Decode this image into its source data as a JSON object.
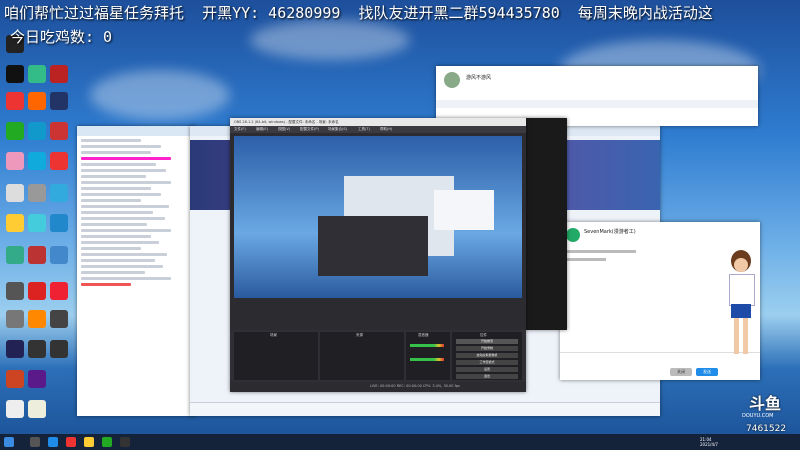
{
  "stream": {
    "marquee": "咱们帮忙过过福星任务拜托  开黑YY: 46280999  找队友进开黑二群594435780  每周末晚内战活动这",
    "chicken_count": "今日吃鸡数: 0",
    "viewer_count": "7461522",
    "watermark_text": "DOUYU.COM"
  },
  "qq_window": {
    "nick": "游风不游风",
    "chat_contact": "SevenMark(漫游者工)",
    "send_button": "发送",
    "close_button": "关闭"
  },
  "obs": {
    "title": "OBS 26.1.2 (64-bit, windows) - 配置文件: 未命名 - 场景: 未命名",
    "menu": [
      "文件(F)",
      "编辑(E)",
      "视图(V)",
      "配置文件(P)",
      "场景集合(S)",
      "工具(T)",
      "帮助(H)"
    ],
    "panels": [
      "场景",
      "来源",
      "混音器",
      "转场特效",
      "控件"
    ],
    "controls": [
      "开始推流",
      "开始录制",
      "启动虚拟摄像机",
      "工作室模式",
      "设置",
      "退出"
    ],
    "status": "LIVE: 00:00:00  REC: 00:00:00  CPU: 3.4%, 30.00 fps"
  },
  "taskbar": {
    "time": "21:04",
    "date": "2021/4/7"
  },
  "colors": {
    "obs_dark": "#2b2b30",
    "qq_blue": "#1e8ce8",
    "douyu_orange": "#ff7700"
  }
}
